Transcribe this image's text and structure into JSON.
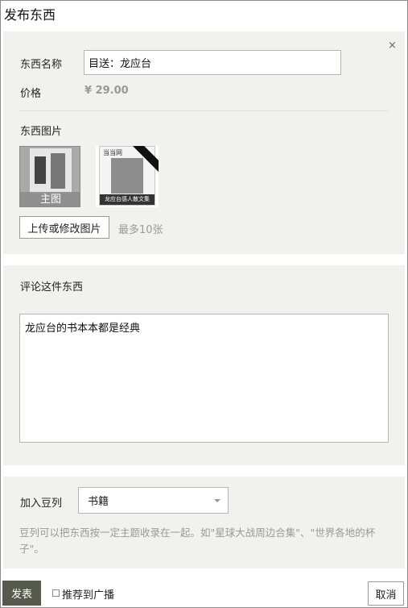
{
  "dialog": {
    "title": "发布东西",
    "close_label": "×"
  },
  "item": {
    "name_label": "东西名称",
    "name_value": "目送：龙应台",
    "price_label": "价格",
    "price_value": "¥ 29.00"
  },
  "images": {
    "section_label": "东西图片",
    "main_label": "主图",
    "thumb2_header": "当当网",
    "thumb2_footer": "龙应台感人散文集",
    "upload_button": "上传或修改图片",
    "limit_hint": "最多10张"
  },
  "review": {
    "label": "评论这件东西",
    "text": "龙应台的书本本都是经典"
  },
  "doulist": {
    "label": "加入豆列",
    "selected": "书籍",
    "description": "豆列可以把东西按一定主题收录在一起。如\"星球大战周边合集\"、\"世界各地的杯子\"。"
  },
  "footer": {
    "publish_button": "发表",
    "share_label": "推荐到广播",
    "share_checked": false,
    "cancel_button": "取消"
  },
  "icons": {
    "close": "close-icon",
    "dropdown": "chevron-down-icon"
  }
}
